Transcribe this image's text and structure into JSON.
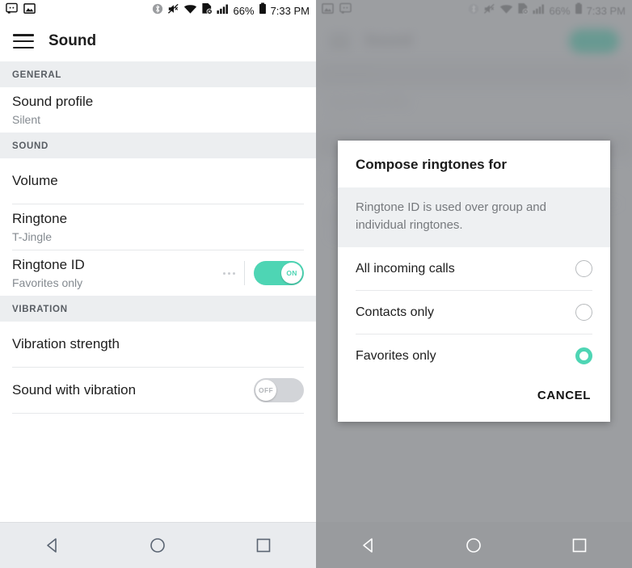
{
  "status_bar": {
    "notifications_left": [
      "message-icon",
      "image-icon"
    ],
    "notifications_right": [
      "image-icon",
      "message-icon"
    ],
    "bluetooth_icon": "bluetooth-icon",
    "mute_icon": "volume-muted-icon",
    "wifi_icon": "wifi-icon",
    "sim_icon": "sim-card-off-icon",
    "signal_icon": "cellular-signal-icon",
    "battery_percent": "66%",
    "battery_icon": "battery-icon",
    "time": "7:33 PM"
  },
  "app_bar": {
    "menu_icon": "hamburger-menu-icon",
    "title": "Sound"
  },
  "settings": {
    "sections": [
      {
        "header": "GENERAL",
        "rows": [
          {
            "title": "Sound profile",
            "subtitle": "Silent",
            "control": "none"
          }
        ]
      },
      {
        "header": "SOUND",
        "rows": [
          {
            "title": "Volume",
            "subtitle": "",
            "control": "none"
          },
          {
            "title": "Ringtone",
            "subtitle": "T-Jingle",
            "control": "none"
          },
          {
            "title": "Ringtone ID",
            "subtitle": "Favorites only",
            "control": "toggle-on",
            "toggle_label": "ON",
            "overflow": "more-options-icon"
          }
        ]
      },
      {
        "header": "VIBRATION",
        "rows": [
          {
            "title": "Vibration strength",
            "subtitle": "",
            "control": "none"
          },
          {
            "title": "Sound with vibration",
            "subtitle": "",
            "control": "toggle-off",
            "toggle_label": "OFF"
          }
        ]
      }
    ]
  },
  "dialog": {
    "title": "Compose ringtones for",
    "subtitle": "Ringtone ID is used over group and individual ringtones.",
    "options": [
      {
        "label": "All incoming calls",
        "selected": false
      },
      {
        "label": "Contacts only",
        "selected": false
      },
      {
        "label": "Favorites only",
        "selected": true
      }
    ],
    "cancel_label": "CANCEL"
  },
  "nav_bar": {
    "back": "back-triangle-icon",
    "home": "home-circle-icon",
    "recents": "recents-square-icon"
  },
  "colors": {
    "accent_teal": "#4ed5b4",
    "toggle_off_gray": "#d2d4d8",
    "section_header_bg": "#eceef0",
    "dialog_subtitle_bg": "#eef0f2",
    "nav_bar_bg": "#e9ebee",
    "scrim": "#808285"
  }
}
